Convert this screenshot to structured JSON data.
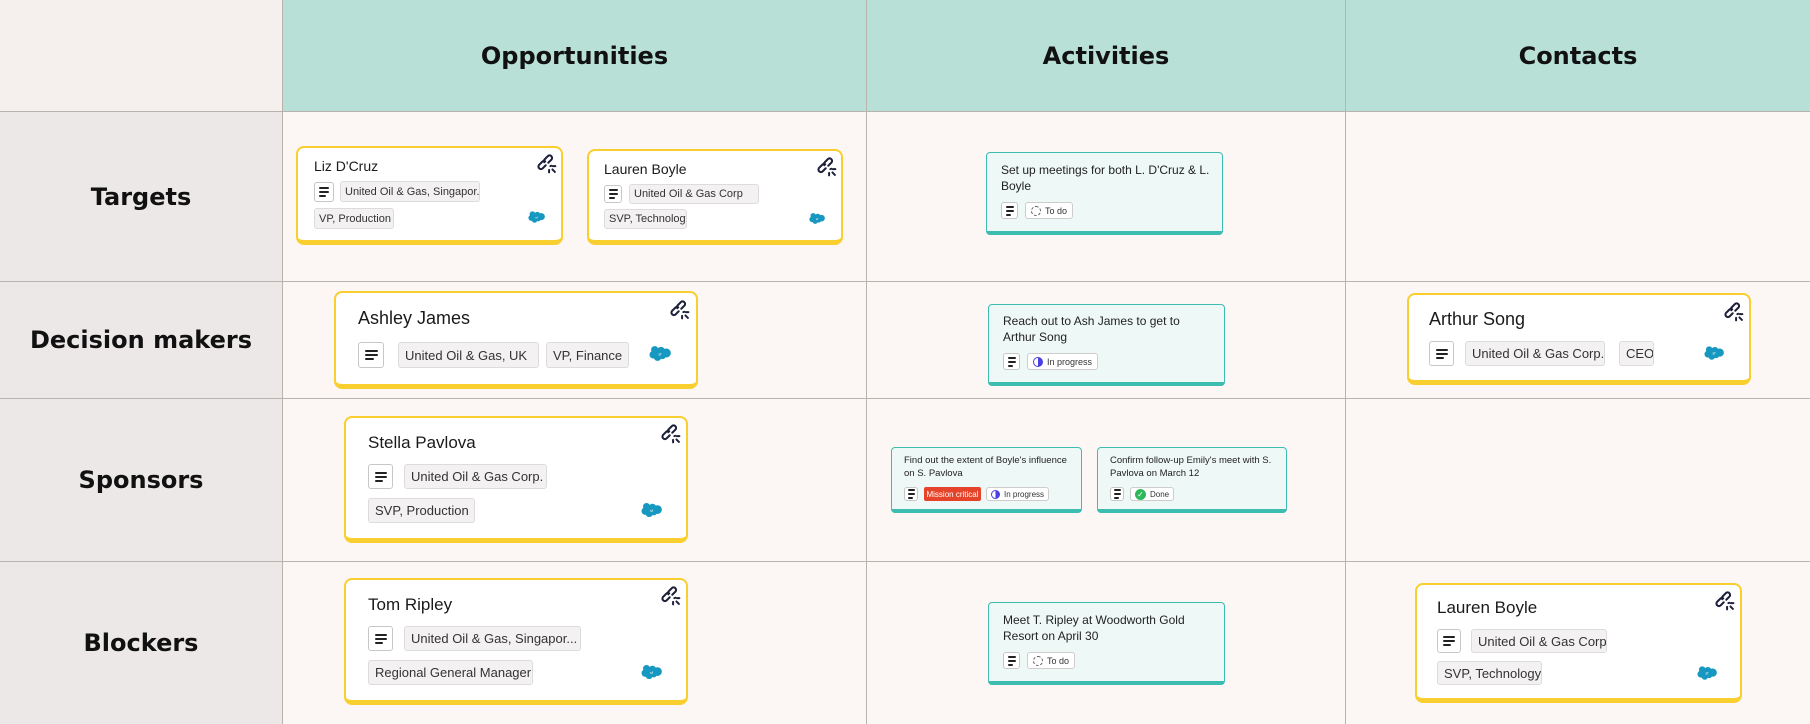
{
  "columns": [
    "Opportunities",
    "Activities",
    "Contacts"
  ],
  "rows": [
    "Targets",
    "Decision makers",
    "Sponsors",
    "Blockers"
  ],
  "opportunities": {
    "targets": [
      {
        "name": "Liz D'Cruz",
        "company": "United Oil & Gas, Singapor...",
        "title": "VP, Production"
      },
      {
        "name": "Lauren Boyle",
        "company": "United Oil & Gas Corp",
        "title": "SVP, Technology"
      }
    ],
    "decision_makers": [
      {
        "name": "Ashley James",
        "company": "United Oil & Gas, UK",
        "title": "VP, Finance"
      }
    ],
    "sponsors": [
      {
        "name": "Stella Pavlova",
        "company": "United Oil & Gas Corp.",
        "title": "SVP, Production"
      }
    ],
    "blockers": [
      {
        "name": "Tom Ripley",
        "company": "United Oil & Gas, Singapor...",
        "title": "Regional General Manager"
      }
    ]
  },
  "activities": {
    "targets": [
      {
        "text": "Set up meetings for both L. D'Cruz & L. Boyle",
        "status": "To do"
      }
    ],
    "decision_makers": [
      {
        "text": "Reach out to Ash James to get to Arthur Song",
        "status": "In progress"
      }
    ],
    "sponsors": [
      {
        "text": "Find out the extent of Boyle's influence on S. Pavlova",
        "badge": "Mission critical",
        "status": "In progress"
      },
      {
        "text": "Confirm follow-up Emily's meet with S. Pavlova on March 12",
        "status": "Done"
      }
    ],
    "blockers": [
      {
        "text": "Meet T. Ripley at Woodworth Gold Resort on April 30",
        "status": "To do"
      }
    ]
  },
  "contacts": {
    "decision_makers": [
      {
        "name": "Arthur Song",
        "company": "United Oil & Gas Corp.",
        "title": "CEO"
      }
    ],
    "blockers": [
      {
        "name": "Lauren Boyle",
        "company": "United Oil & Gas Corp",
        "title": "SVP, Technology"
      }
    ]
  },
  "colors": {
    "header_bg": "#b8e0d6",
    "row_header_bg": "#ede8e8",
    "canvas_bg": "#fcf7f4",
    "card_border": "#f9cf2f",
    "activity_border": "#3dbcb0",
    "salesforce_blue": "#1798c1",
    "mission_critical_red": "#e5432a",
    "in_progress_indigo": "#4a3fe0",
    "done_green": "#2eb85c"
  },
  "icons": [
    "unlink-icon",
    "description-icon",
    "salesforce-icon",
    "status-todo-icon",
    "status-in-progress-icon",
    "status-done-icon"
  ]
}
